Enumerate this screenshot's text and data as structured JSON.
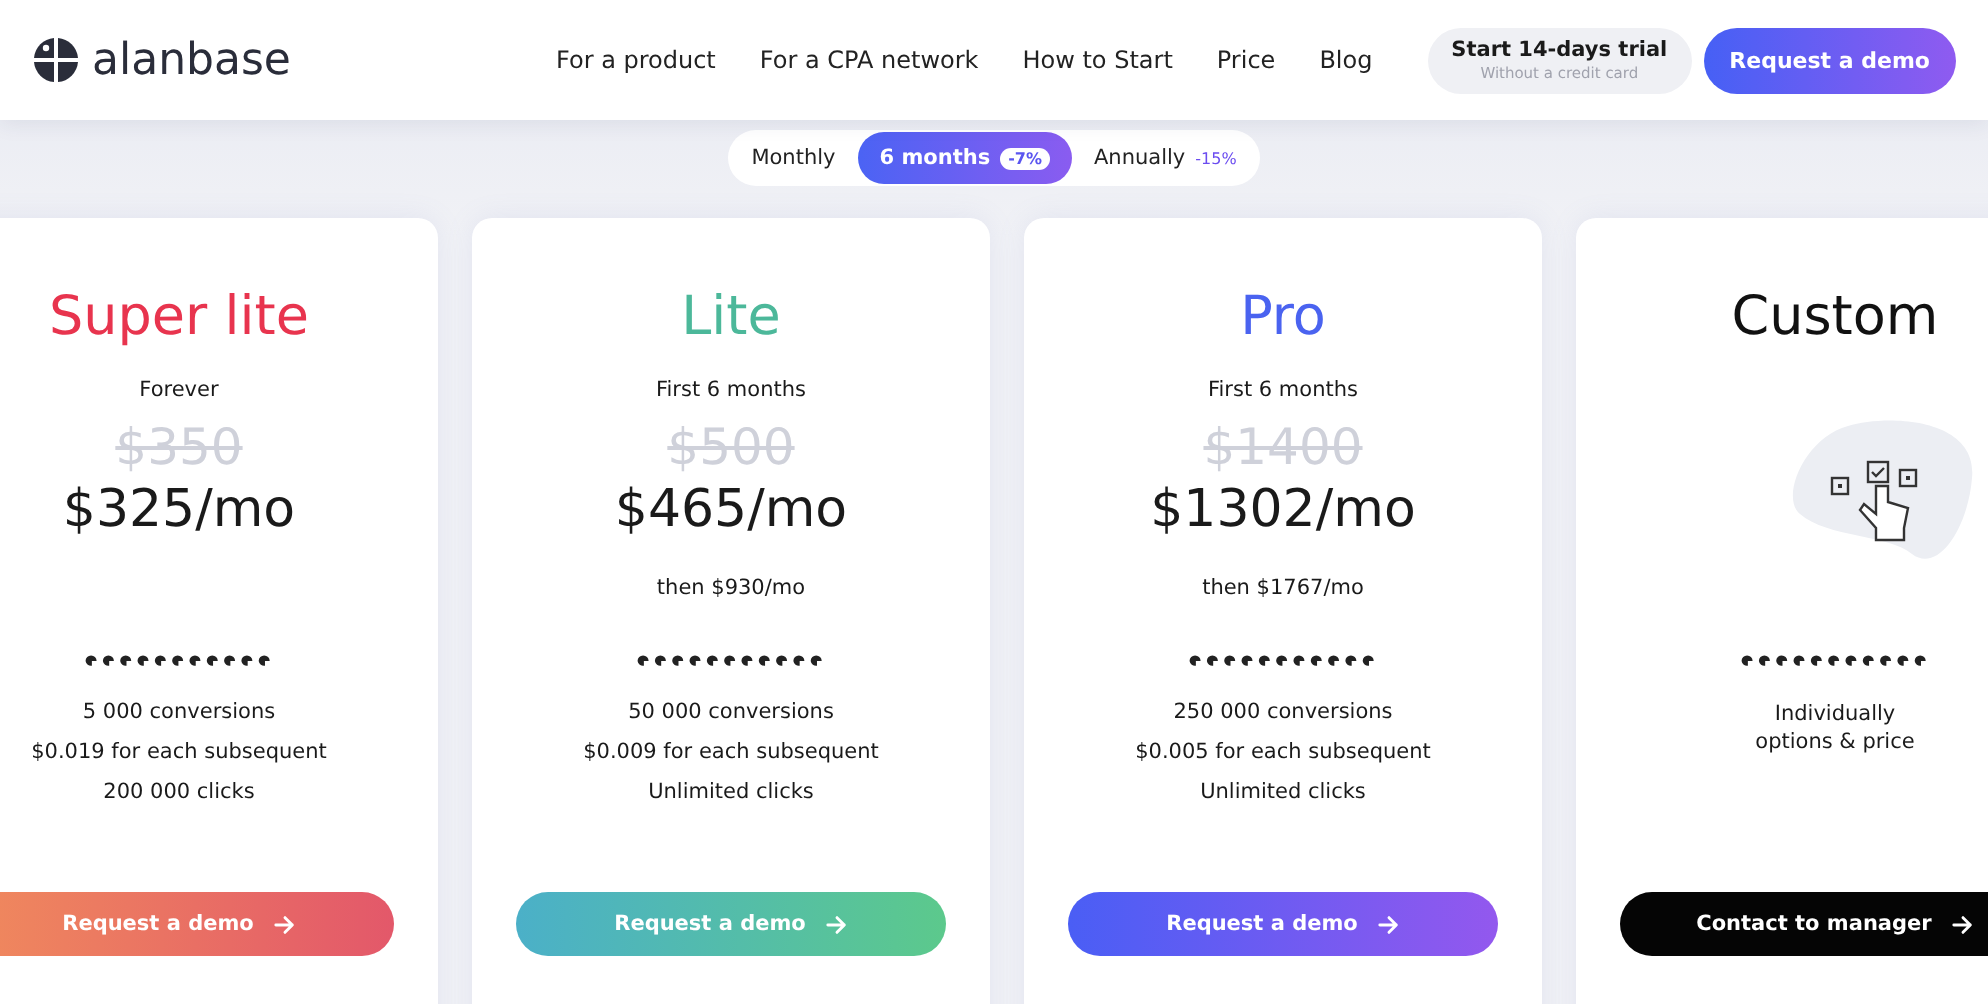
{
  "header": {
    "logo": "alanbase",
    "nav": [
      "For a product",
      "For a CPA network",
      "How to Start",
      "Price",
      "Blog"
    ],
    "trial": {
      "label": "Start 14-days trial",
      "note": "Without a credit card"
    },
    "demo_button": "Request a demo"
  },
  "billing_tabs": [
    {
      "label": "Monthly",
      "selected": false
    },
    {
      "label": "6 months",
      "badge": "-7%",
      "selected": true
    },
    {
      "label": "Annually",
      "badge": "-15%",
      "selected": false
    }
  ],
  "plans": [
    {
      "kind": "priced",
      "name": "Super lite",
      "color": "#e8344e",
      "period": "Forever",
      "old_price": "$350",
      "price": "$325",
      "unit": "/mo",
      "features": [
        "5 000 conversions",
        "$0.019 for each subsequent",
        "200 000 clicks"
      ],
      "button": {
        "label": "Request a demo",
        "kind": "coral"
      }
    },
    {
      "kind": "priced",
      "name": "Lite",
      "color": "#4cb89a",
      "period": "First 6 months",
      "old_price": "$500",
      "price": "$465",
      "unit": "/mo",
      "then": "then $930/mo",
      "features": [
        "50 000 conversions",
        "$0.009 for each subsequent",
        "Unlimited clicks"
      ],
      "button": {
        "label": "Request a demo",
        "kind": "teal"
      }
    },
    {
      "kind": "priced",
      "name": "Pro",
      "color": "#4a63f0",
      "period": "First 6 months",
      "old_price": "$1400",
      "price": "$1302",
      "unit": "/mo",
      "then": "then $1767/mo",
      "features": [
        "250 000 conversions",
        "$0.005 for each subsequent",
        "Unlimited clicks"
      ],
      "button": {
        "label": "Request a demo",
        "kind": "violet"
      }
    },
    {
      "kind": "custom",
      "name": "Custom",
      "color": "#111111",
      "features": [
        "Individually options & price"
      ],
      "button": {
        "label": "Contact to manager",
        "kind": "dark"
      }
    }
  ]
}
